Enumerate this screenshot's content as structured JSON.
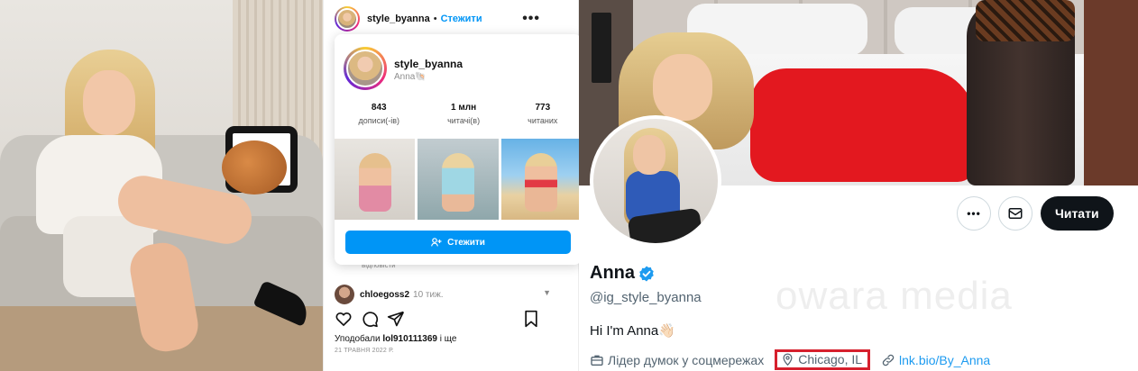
{
  "instagram": {
    "header": {
      "username": "style_byanna",
      "separator": "•",
      "follow_link": "Стежити",
      "more_label": "•••"
    },
    "hover_card": {
      "username": "style_byanna",
      "display_name": "Anna🐚",
      "stats": [
        {
          "value": "843",
          "label": "дописи(-ів)"
        },
        {
          "value": "1 млн",
          "label": "читачі(в)"
        },
        {
          "value": "773",
          "label": "читаних"
        }
      ],
      "follow_button": "Стежити"
    },
    "replies_text": "відповісти",
    "comment": {
      "username": "chloegoss2",
      "time": "10 тиж."
    },
    "likes_prefix": "Уподобали",
    "likes_user": "lol910111369",
    "likes_suffix": "і ще",
    "date": "21 ТРАВНЯ 2022 Р."
  },
  "twitter": {
    "buttons": {
      "more_label": "•••",
      "follow": "Читати"
    },
    "name": "Anna",
    "handle": "@ig_style_byanna",
    "bio": "Hi I'm Anna👋🏻",
    "watermark": "owara media",
    "category": "Лідер думок у соцмережах",
    "location": "Chicago, IL",
    "link": "lnk.bio/By_Anna",
    "colors": {
      "verified": "#1d9bf0",
      "highlight_box": "#d6202d",
      "follow_button_bg": "#0f1419"
    }
  }
}
